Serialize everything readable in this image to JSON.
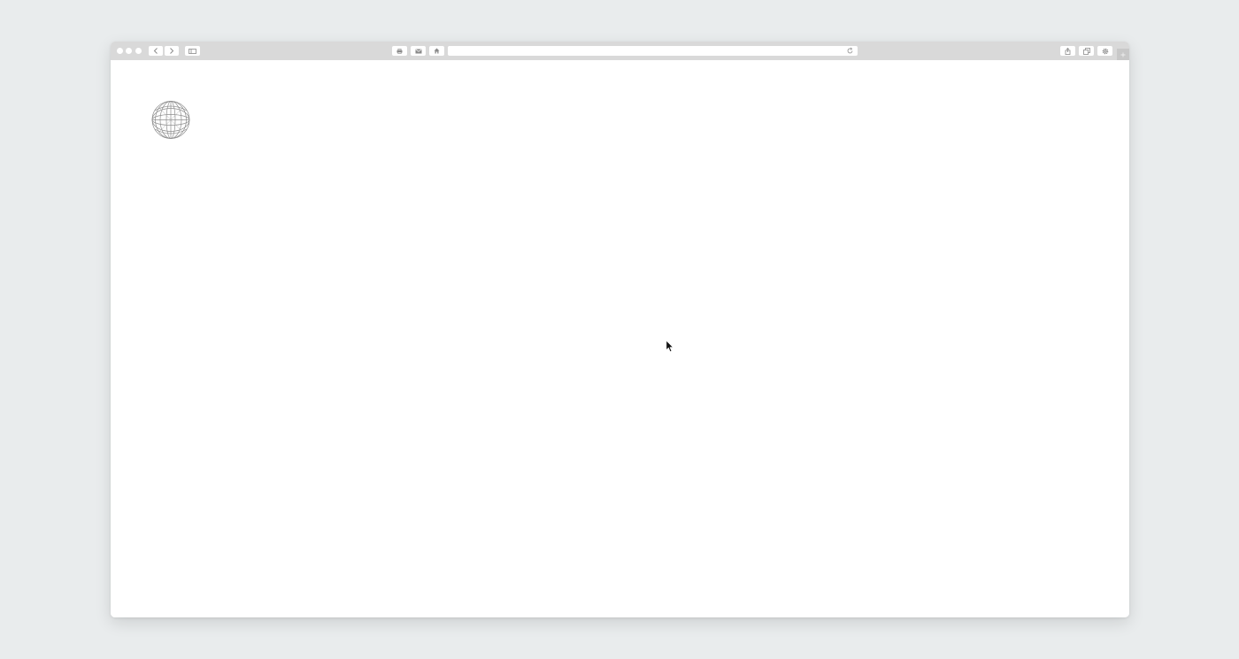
{
  "browser": {
    "toolbar": {
      "traffic_lights": [
        "close",
        "minimize",
        "zoom"
      ],
      "nav_icons": [
        "back-icon",
        "forward-icon",
        "sidebar-icon"
      ],
      "center_icons": [
        "print-icon",
        "mail-icon",
        "home-icon"
      ],
      "address_bar": {
        "value": "",
        "reload_icon": "reload-icon"
      },
      "right_icons": [
        "share-icon",
        "tabs-icon",
        "settings-icon"
      ],
      "new_tab_icon": "plus-icon"
    }
  },
  "page": {
    "logo_icon": "globe-wireframe-icon",
    "cursor_icon": "mouse-pointer-icon"
  },
  "colors": {
    "desktop_bg": "#e9eced",
    "toolbar_bg": "#d9d9d9",
    "content_bg": "#ffffff",
    "icon_gray": "#8a8a8a"
  }
}
